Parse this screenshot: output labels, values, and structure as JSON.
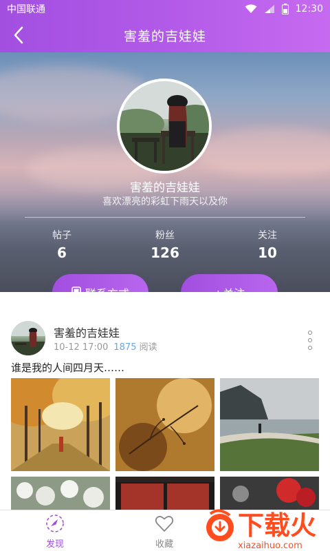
{
  "status_bar": {
    "carrier": "中国联通",
    "time": "12:30"
  },
  "header": {
    "title": "害羞的吉娃娃"
  },
  "profile": {
    "name": "害羞的吉娃娃",
    "bio": "喜欢漂亮的彩虹下雨天以及你",
    "stats": [
      {
        "label": "帖子",
        "value": "6"
      },
      {
        "label": "粉丝",
        "value": "126"
      },
      {
        "label": "关注",
        "value": "10"
      }
    ],
    "contact_label": "联系方式",
    "follow_label": "+关注"
  },
  "post": {
    "author": "害羞的吉娃娃",
    "date": "10-12 17:00",
    "read_count": "1875",
    "read_label": "阅读",
    "text": "谁是我的人间四月天……"
  },
  "tabs": [
    {
      "label": "发现",
      "icon": "compass-icon",
      "active": true
    },
    {
      "label": "收藏",
      "icon": "heart-icon",
      "active": false
    }
  ],
  "watermark": {
    "text": "下载火",
    "url": "xiazaihuo.com"
  },
  "colors": {
    "accent": "#a24fe0",
    "link": "#6aa6e6",
    "watermark": "#ff4d1f"
  }
}
